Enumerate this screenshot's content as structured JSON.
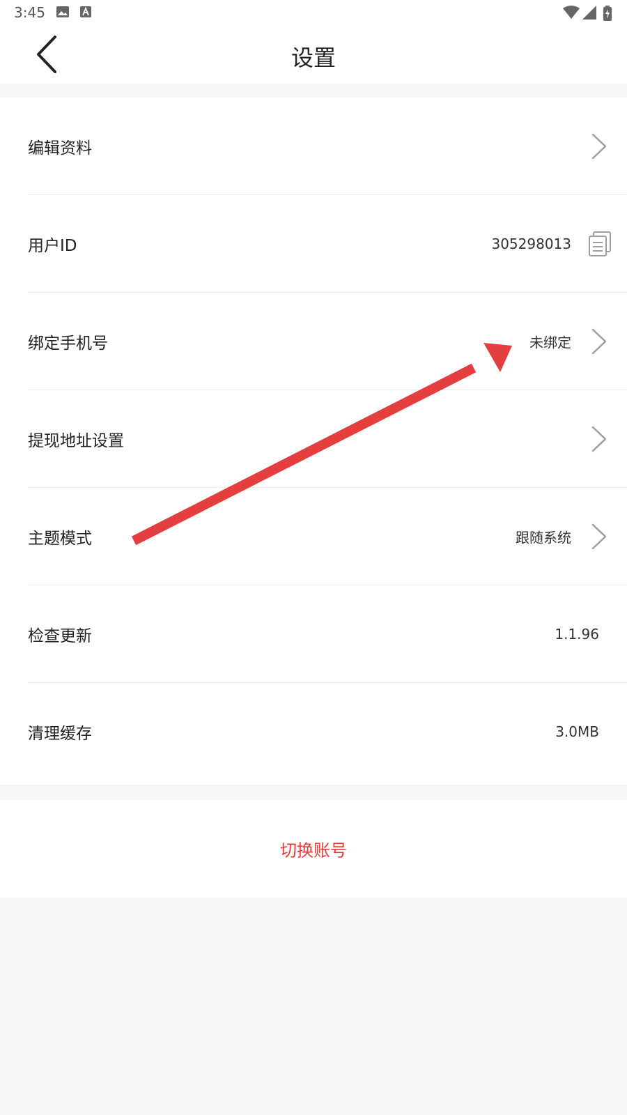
{
  "status_bar": {
    "time": "3:45",
    "icons": [
      "image-icon",
      "text-badge-icon",
      "wifi-icon",
      "signal-icon",
      "battery-icon"
    ]
  },
  "header": {
    "title": "设置",
    "back_icon": "chevron-left-icon"
  },
  "settings": {
    "items": [
      {
        "label": "编辑资料",
        "value": "",
        "trailing_icon": "chevron-right-icon"
      },
      {
        "label": "用户ID",
        "value": "305298013",
        "trailing_icon": "copy-icon"
      },
      {
        "label": "绑定手机号",
        "value": "未绑定",
        "trailing_icon": "chevron-right-icon"
      },
      {
        "label": "提现地址设置",
        "value": "",
        "trailing_icon": "chevron-right-icon"
      },
      {
        "label": "主题模式",
        "value": "跟随系统",
        "trailing_icon": "chevron-right-icon"
      },
      {
        "label": "检查更新",
        "value": "1.1.96",
        "trailing_icon": ""
      },
      {
        "label": "清理缓存",
        "value": "3.0MB",
        "trailing_icon": ""
      }
    ]
  },
  "actions": {
    "switch_account": "切换账号"
  },
  "colors": {
    "accent_red": "#e53935",
    "annotation_arrow": "#e53e3e",
    "background": "#f5f6f6",
    "chevron": "#9e9e9e"
  }
}
